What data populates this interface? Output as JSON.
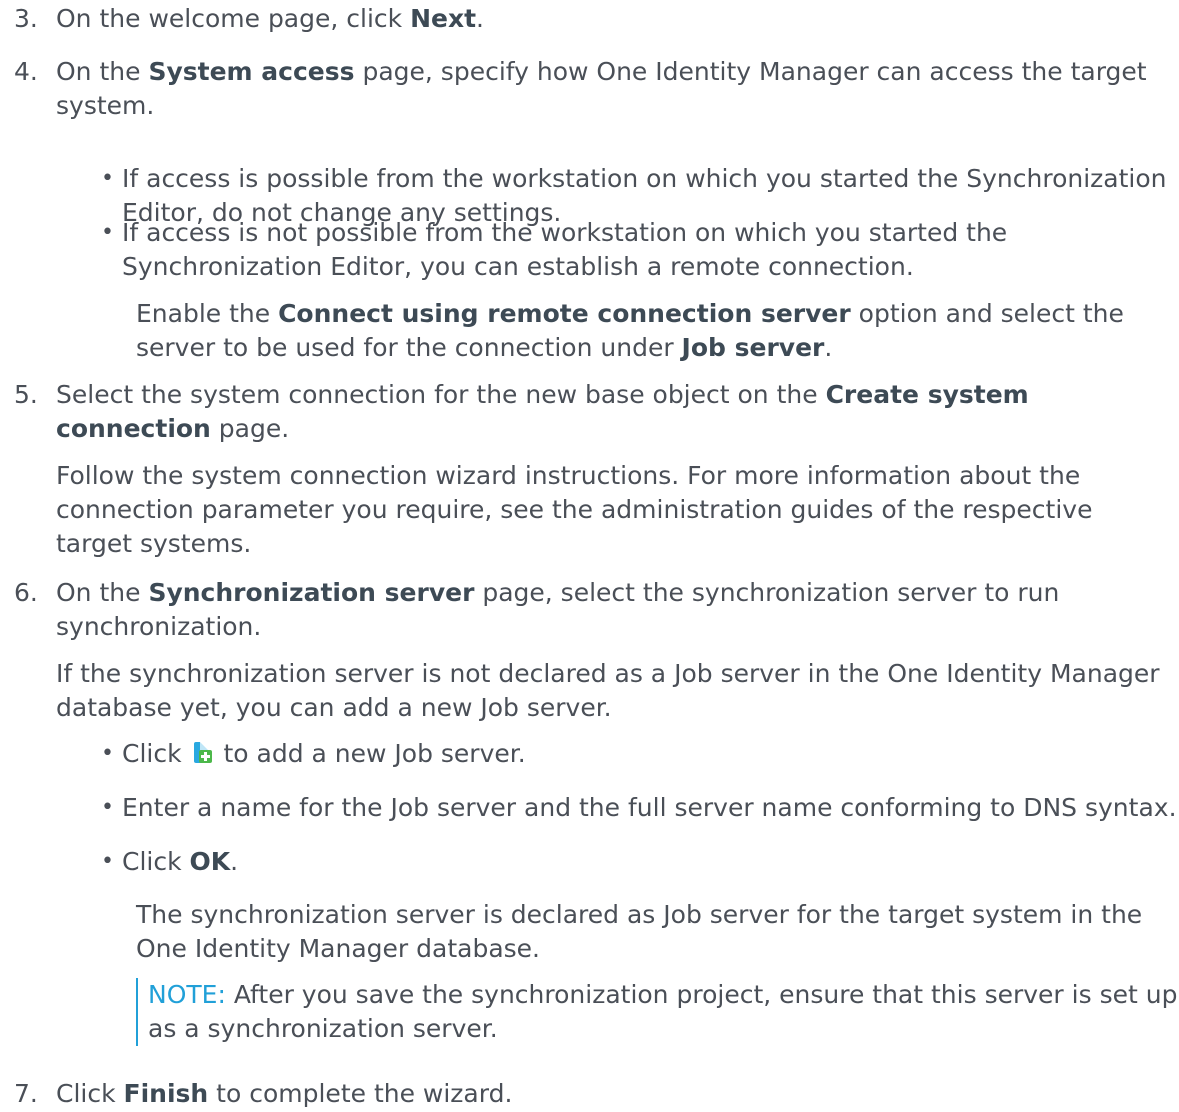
{
  "step3": {
    "num": "3.",
    "t1": "On the welcome page, click ",
    "b1": "Next",
    "t2": "."
  },
  "step4": {
    "num": "4.",
    "t1": "On the ",
    "b1": "System access",
    "t2": " page, specify how One Identity Manager can access the target system.",
    "bullet1": "If access is possible from the workstation on which you started the Synchronization Editor, do not change any settings.",
    "bullet2": "If access is not possible from the workstation on which you started the Synchronization Editor, you can establish a remote connection.",
    "remote": {
      "t1": "Enable the ",
      "b1": "Connect using remote connection server",
      "t2": " option and select the server to be used for the connection under ",
      "b2": "Job server",
      "t3": "."
    }
  },
  "step5": {
    "num": "5.",
    "t1": "Select the system connection for the new base object on the ",
    "b1": "Create system connection",
    "t2": " page.",
    "para": "Follow the system connection wizard instructions. For more information about the connection parameter you require, see the administration guides of the respective target systems."
  },
  "step6": {
    "num": "6.",
    "t1": "On the ",
    "b1": "Synchronization server",
    "t2": " page, select the synchronization server to run synchronization.",
    "para": "If the synchronization server is not declared as a Job server in the One Identity Manager database yet, you can add a new Job server.",
    "bullet1": {
      "t1": "Click ",
      "icon": "add-job-server-icon",
      "t2": " to add a new Job server."
    },
    "bullet2": "Enter a name for the Job server and the full server name conforming to DNS  syntax.",
    "bullet3": {
      "t1": "Click ",
      "b1": "OK",
      "t2": "."
    },
    "declared": "The synchronization server is declared as Job server for the target system in the One Identity Manager database.",
    "note": {
      "label": "NOTE:",
      "text": " After you save the synchronization project, ensure that this server is set up as a synchronization server."
    }
  },
  "step7": {
    "num": "7.",
    "t1": "Click ",
    "b1": "Finish",
    "t2": " to complete the wizard."
  }
}
